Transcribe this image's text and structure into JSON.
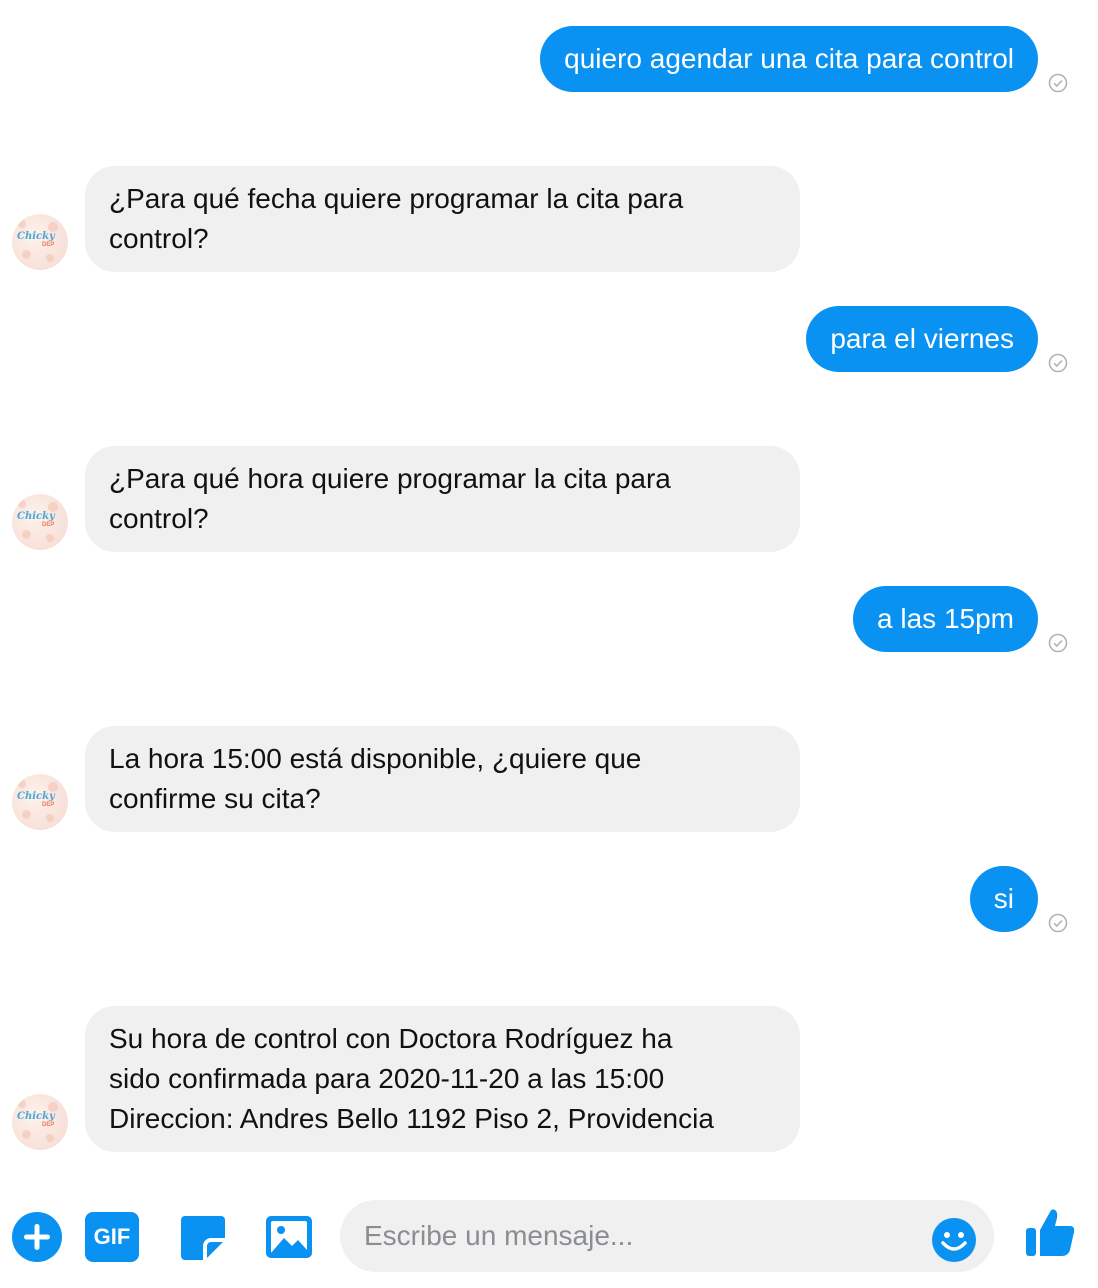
{
  "messages": [
    {
      "from": "user",
      "text": "quiero agendar una cita para control"
    },
    {
      "from": "bot",
      "lines": [
        "¿Para qué fecha quiere programar la cita para",
        "control?"
      ]
    },
    {
      "from": "user",
      "text": "para el viernes"
    },
    {
      "from": "bot",
      "lines": [
        "¿Para qué hora quiere programar la cita para",
        "control?"
      ]
    },
    {
      "from": "user",
      "text": "a las 15pm"
    },
    {
      "from": "bot",
      "lines": [
        "La hora 15:00 está disponible, ¿quiere que",
        "confirme su cita?"
      ]
    },
    {
      "from": "user",
      "text": "si"
    },
    {
      "from": "bot",
      "lines": [
        "Su hora de control con Doctora Rodríguez ha",
        "sido confirmada para 2020-11-20 a las 15:00",
        "Direccion: Andres Bello 1192 Piso 2, Providencia"
      ]
    }
  ],
  "avatar": {
    "brand": "Chicky",
    "brand_sub": "DEP"
  },
  "composer": {
    "placeholder": "Escribe un mensaje...",
    "gif_label": "GIF",
    "icons": [
      "plus-icon",
      "gif-icon",
      "sticker-icon",
      "image-icon",
      "emoji-icon",
      "thumbs-up-icon"
    ]
  },
  "colors": {
    "accent": "#0a92f2",
    "bot_bubble": "#f0f0f0",
    "check": "#b0b3b8"
  }
}
